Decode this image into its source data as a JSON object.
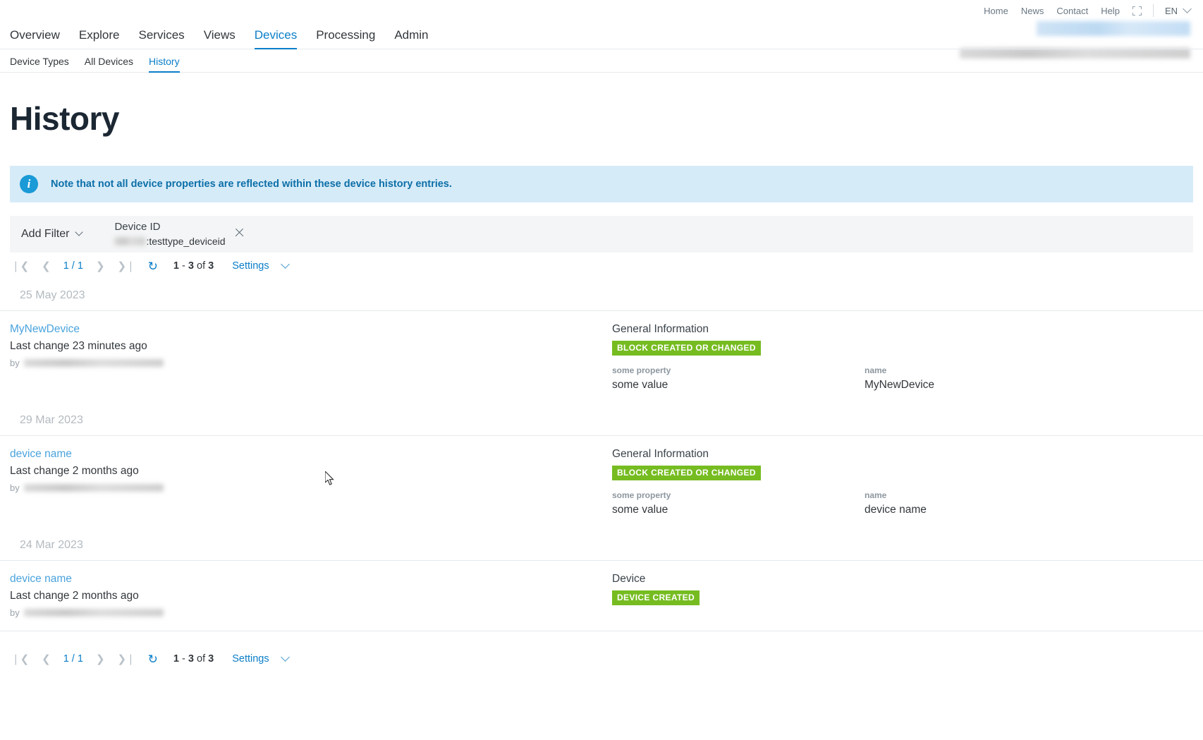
{
  "meta": {
    "links": [
      "Home",
      "News",
      "Contact",
      "Help"
    ],
    "fullscreen_icon": "fullscreen-icon",
    "language": "EN"
  },
  "nav": {
    "primary": [
      {
        "label": "Overview",
        "active": false
      },
      {
        "label": "Explore",
        "active": false
      },
      {
        "label": "Services",
        "active": false
      },
      {
        "label": "Views",
        "active": false
      },
      {
        "label": "Devices",
        "active": true
      },
      {
        "label": "Processing",
        "active": false
      },
      {
        "label": "Admin",
        "active": false
      }
    ],
    "secondary": [
      {
        "label": "Device Types",
        "active": false
      },
      {
        "label": "All Devices",
        "active": false
      },
      {
        "label": "History",
        "active": true
      }
    ]
  },
  "page": {
    "title": "History"
  },
  "banner": {
    "icon": "info-icon",
    "icon_glyph": "i",
    "text": "Note that not all device properties are reflected within these device history entries.",
    "background": "#d6ebf8",
    "text_color": "#0d6fa8"
  },
  "filter": {
    "add_filter_label": "Add Filter",
    "chip": {
      "label": "Device ID",
      "value_suffix": ":testtype_deviceid",
      "remove_icon": "close-icon"
    }
  },
  "pager": {
    "first_icon": "❘❮",
    "prev_icon": "❮",
    "position": "1 / 1",
    "next_icon": "❯",
    "last_icon": "❯❘",
    "refresh_icon": "↻",
    "range_from": "1",
    "range_dash": "-",
    "range_to": "3",
    "of_label": "of",
    "total": "3",
    "settings_label": "Settings"
  },
  "groups": [
    {
      "date": "25 May 2023",
      "entries": [
        {
          "device": "MyNewDevice",
          "change": "Last change 23 minutes ago",
          "by_label": "by",
          "section": "General Information",
          "badge": "BLOCK CREATED OR CHANGED",
          "badge_color": "#76bc21",
          "properties": [
            {
              "key": "some property",
              "value": "some value"
            },
            {
              "key": "name",
              "value": "MyNewDevice"
            }
          ]
        }
      ]
    },
    {
      "date": "29 Mar 2023",
      "entries": [
        {
          "device": "device name",
          "change": "Last change 2 months ago",
          "by_label": "by",
          "section": "General Information",
          "badge": "BLOCK CREATED OR CHANGED",
          "badge_color": "#76bc21",
          "properties": [
            {
              "key": "some property",
              "value": "some value"
            },
            {
              "key": "name",
              "value": "device name"
            }
          ]
        }
      ]
    },
    {
      "date": "24 Mar 2023",
      "entries": [
        {
          "device": "device name",
          "change": "Last change 2 months ago",
          "by_label": "by",
          "section": "Device",
          "badge": "DEVICE CREATED",
          "badge_color": "#76bc21",
          "properties": []
        }
      ]
    }
  ],
  "pager_bottom": {
    "first_icon": "❘❮",
    "prev_icon": "❮",
    "position": "1 / 1",
    "next_icon": "❯",
    "last_icon": "❯❘",
    "refresh_icon": "↻",
    "range_from": "1",
    "range_dash": "-",
    "range_to": "3",
    "of_label": "of",
    "total": "3",
    "settings_label": "Settings"
  },
  "colors": {
    "accent": "#0a7ec8",
    "link": "#4aa3dd",
    "badge_green": "#76bc21",
    "banner_blue": "#d6ebf8"
  }
}
